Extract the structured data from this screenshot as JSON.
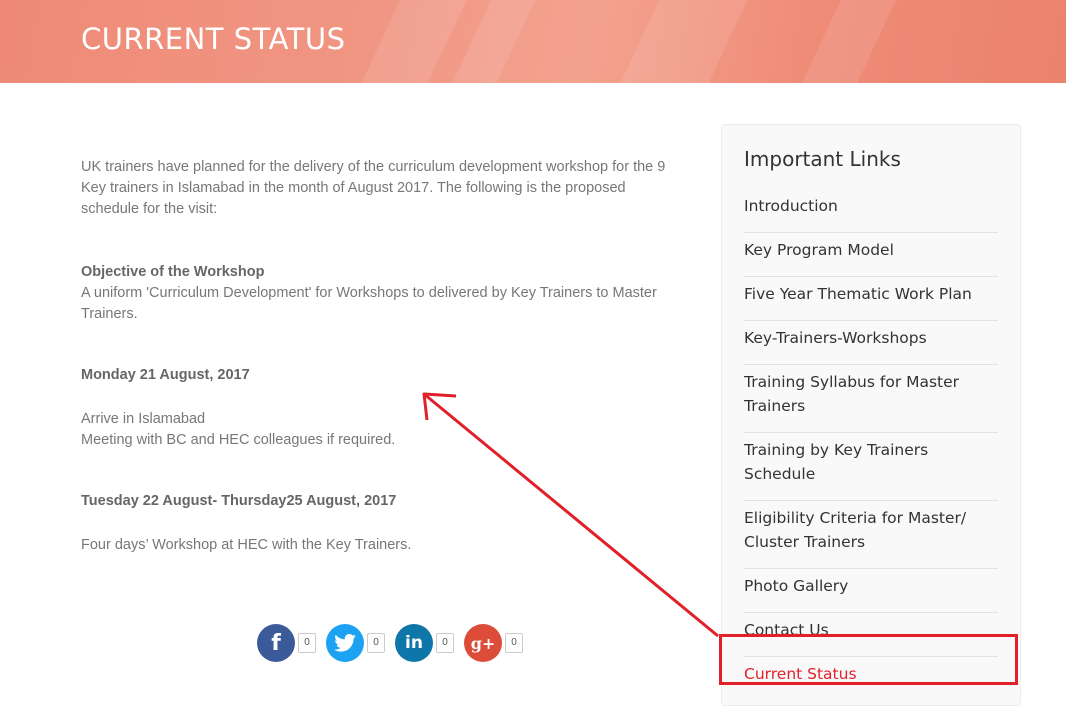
{
  "banner": {
    "title": "CURRENT STATUS"
  },
  "content": {
    "intro": "UK trainers have planned  for the delivery of the curriculum development workshop for the 9 Key trainers in Islamabad in the month of August 2017. The following is the proposed schedule for the visit:",
    "objective_heading": "Objective of the Workshop",
    "objective_text": "A uniform 'Curriculum Development' for Workshops to delivered by Key Trainers to Master Trainers.",
    "day1_heading": "Monday 21 August, 2017",
    "day1_line1": "Arrive in Islamabad",
    "day1_line2": "Meeting with BC and HEC colleagues if required.",
    "day2_heading": "Tuesday 22 August- Thursday25 August, 2017",
    "day2_line1": "Four days’ Workshop at HEC with the Key Trainers."
  },
  "share": [
    {
      "icon": "facebook-icon",
      "glyph": "f",
      "color": "#3b5a9a",
      "count": "0"
    },
    {
      "icon": "twitter-icon",
      "glyph": "🐦",
      "color": "#1da1f2",
      "count": "0"
    },
    {
      "icon": "linkedin-icon",
      "glyph": "in",
      "color": "#0e76a8",
      "count": "0"
    },
    {
      "icon": "google-plus-icon",
      "glyph": "g+",
      "color": "#dd4b39",
      "count": "0"
    }
  ],
  "sidebar": {
    "title": "Important Links",
    "links": [
      "Introduction",
      "Key Program Model",
      "Five Year Thematic Work Plan",
      "Key-Trainers-Workshops",
      "Training Syllabus for Master Trainers",
      "Training by Key Trainers Schedule",
      "Eligibility Criteria for Master/ Cluster Trainers",
      "Photo Gallery",
      "Contact Us",
      "Current Status"
    ]
  },
  "colors": {
    "accent": "#e2202a",
    "banner": "#f19684"
  }
}
